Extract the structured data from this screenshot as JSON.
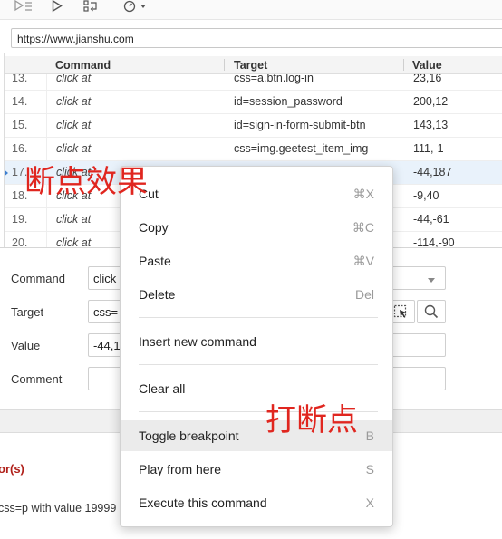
{
  "toolbar": {
    "icons": [
      "run-all-icon",
      "run-current-icon",
      "step-icon",
      "speed-icon"
    ]
  },
  "url_bar": {
    "value": "https://www.jianshu.com"
  },
  "table": {
    "headers": {
      "command": "Command",
      "target": "Target",
      "value": "Value"
    },
    "rows": [
      {
        "num": "13.",
        "command": "click at",
        "target": "css=a.btn.log-in",
        "value": "23,16"
      },
      {
        "num": "14.",
        "command": "click at",
        "target": "id=session_password",
        "value": "200,12"
      },
      {
        "num": "15.",
        "command": "click at",
        "target": "id=sign-in-form-submit-btn",
        "value": "143,13"
      },
      {
        "num": "16.",
        "command": "click at",
        "target": "css=img.geetest_item_img",
        "value": "111,-1"
      },
      {
        "num": "17.",
        "command": "click at",
        "target": "",
        "value": "-44,187",
        "breakpoint": true,
        "selected": true
      },
      {
        "num": "18.",
        "command": "click at",
        "target": "",
        "value": "-9,40"
      },
      {
        "num": "19.",
        "command": "click at",
        "target": "",
        "value": "-44,-61"
      },
      {
        "num": "20.",
        "command": "click at",
        "target": "",
        "value": "-114,-90"
      }
    ]
  },
  "form": {
    "command_label": "Command",
    "command_value": "click",
    "target_label": "Target",
    "target_value": "css=",
    "value_label": "Value",
    "value_value": "-44,1",
    "comment_label": "Comment",
    "comment_value": ""
  },
  "log": {
    "error_text": "or(s)",
    "line_text": "css=p with value 19999"
  },
  "context_menu": {
    "items": [
      {
        "label": "Cut",
        "shortcut": "⌘X"
      },
      {
        "label": "Copy",
        "shortcut": "⌘C"
      },
      {
        "label": "Paste",
        "shortcut": "⌘V"
      },
      {
        "label": "Delete",
        "shortcut": "Del"
      },
      {
        "label": "Insert new command",
        "shortcut": ""
      },
      {
        "label": "Clear all",
        "shortcut": ""
      },
      {
        "label": "Toggle breakpoint",
        "shortcut": "B"
      },
      {
        "label": "Play from here",
        "shortcut": "S"
      },
      {
        "label": "Execute this command",
        "shortcut": "X"
      }
    ]
  },
  "annotations": {
    "breakpoint_effect": "断点效果",
    "set_breakpoint": "打断点",
    "color": "#e0261f"
  }
}
